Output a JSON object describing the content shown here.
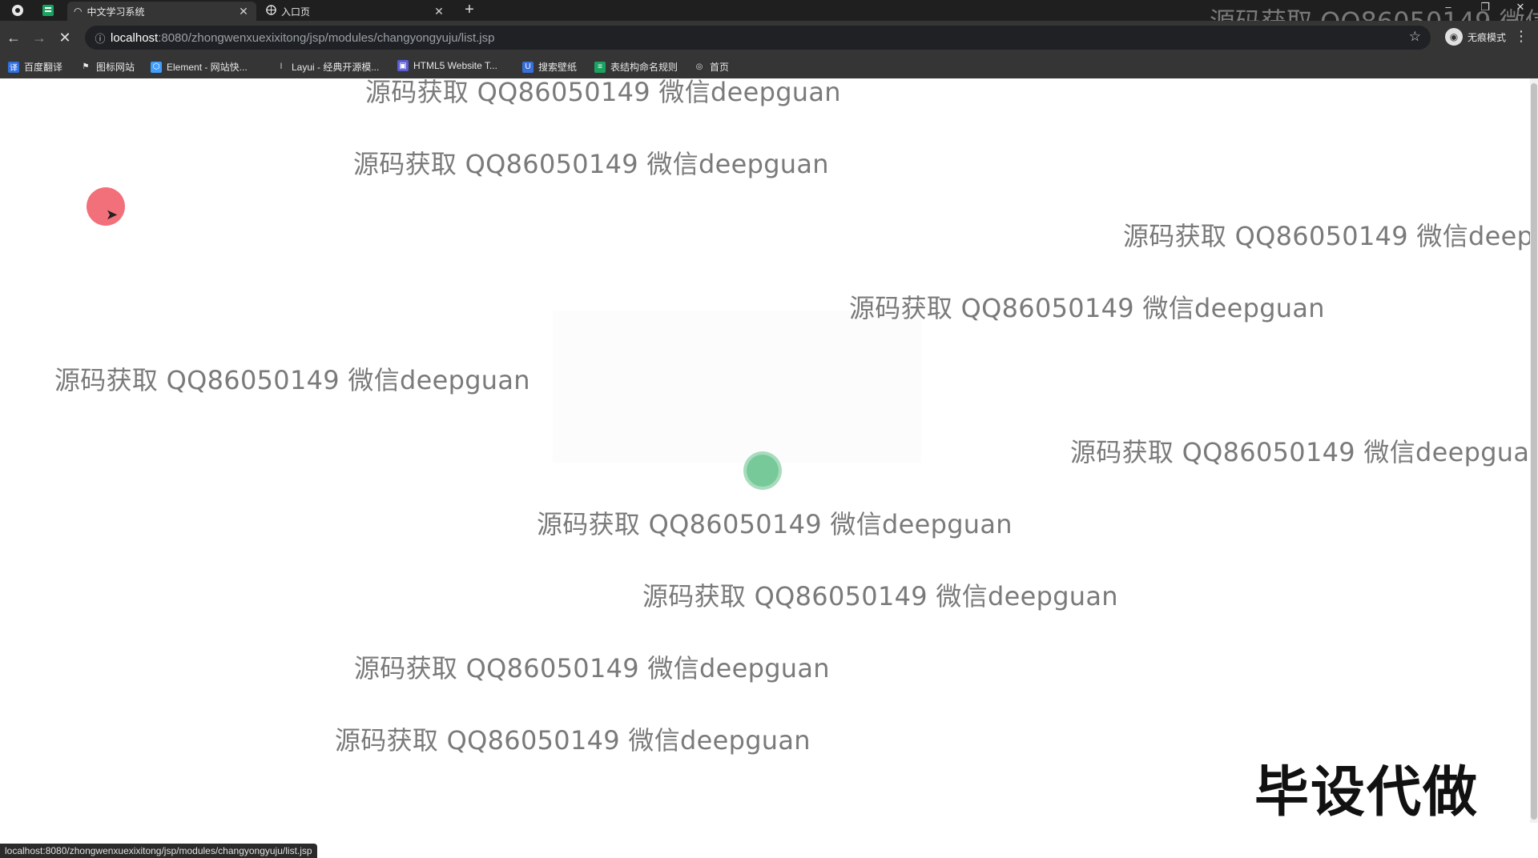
{
  "browser": {
    "tabs": [
      {
        "label": "中文学习系统",
        "active": true,
        "loading": true
      },
      {
        "label": "入口页",
        "active": false
      }
    ],
    "url_host": "localhost",
    "url_path": ":8080/zhongwenxuexixitong/jsp/modules/changyongyuju/list.jsp",
    "incognito_label": "无痕模式",
    "bookmarks": [
      {
        "label": "百度翻译",
        "icon": "translate-icon",
        "color": "#2f6fe0"
      },
      {
        "label": "图标网站",
        "icon": "flag-icon",
        "color": "#444444"
      },
      {
        "label": "Element - 网站快...",
        "icon": "element-icon",
        "color": "#409eff"
      },
      {
        "label": "Layui - 经典开源模...",
        "icon": "layui-icon",
        "color": "#555555"
      },
      {
        "label": "HTML5 Website T...",
        "icon": "html5-icon",
        "color": "#5b5bd6"
      },
      {
        "label": "搜索壁纸",
        "icon": "wallpaper-icon",
        "color": "#3a6fd8"
      },
      {
        "label": "表结构命名规则",
        "icon": "doc-icon",
        "color": "#1aa260"
      },
      {
        "label": "首页",
        "icon": "globe-icon",
        "color": "#666666"
      }
    ],
    "status_url": "localhost:8080/zhongwenxuexixitong/jsp/modules/changyongyuju/list.jsp"
  },
  "watermark": {
    "text": "源码获取 QQ86050149 微信deepguan",
    "top_right_text": "源码获取 QQ86050149 微信d"
  },
  "stamp": "毕设代做"
}
